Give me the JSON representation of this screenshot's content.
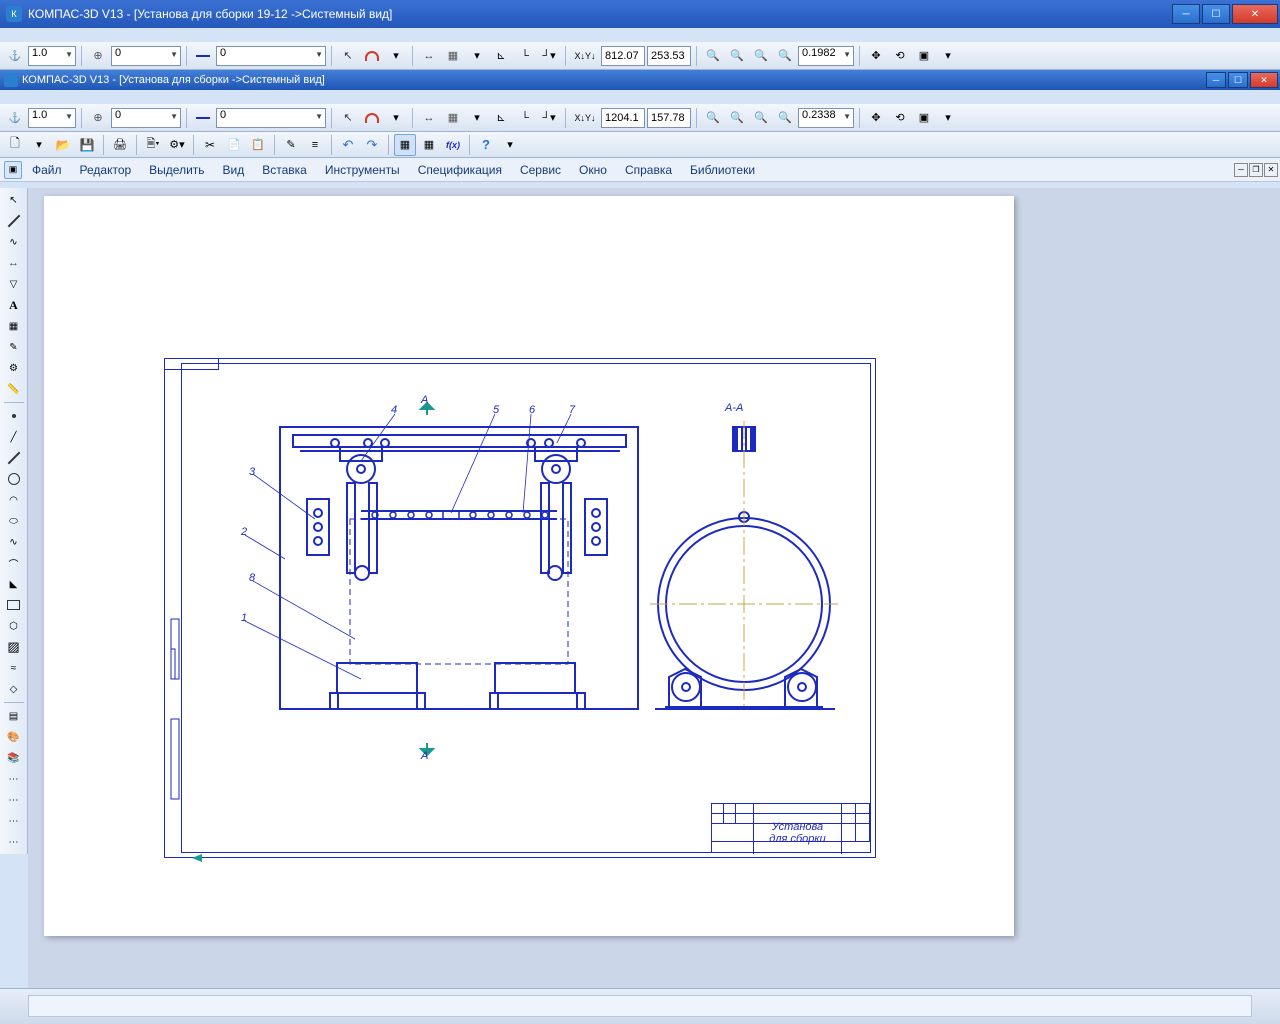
{
  "app": {
    "title": "КОМПАС-3D V13 - [Установа для  сборки 19-12 ->Системный вид]",
    "doc_title": "КОМПАС-3D V13 - [Установа для сборки ->Системный вид]"
  },
  "toolbar1": {
    "scale": "1.0",
    "step": "0",
    "style": "0",
    "coord_x": "812.07",
    "coord_y": "253.53",
    "zoom": "0.1982"
  },
  "toolbar2": {
    "scale": "1.0",
    "step": "0",
    "style": "0",
    "coord_x": "1204.1",
    "coord_y": "157.78",
    "zoom": "0.2338"
  },
  "menu": {
    "file": "Файл",
    "editor": "Редактор",
    "select": "Выделить",
    "view": "Вид",
    "insert": "Вставка",
    "tools": "Инструменты",
    "specification": "Спецификация",
    "service": "Сервис",
    "window": "Окно",
    "help": "Справка",
    "libraries": "Библиотеки"
  },
  "drawing": {
    "section_label": "А-А",
    "titleblock_name1": "Установа",
    "titleblock_name2": "для сборки",
    "leader_1": "1",
    "leader_2": "2",
    "leader_3": "3",
    "leader_4": "4",
    "leader_5": "5",
    "leader_6": "6",
    "leader_7": "7",
    "leader_8": "8",
    "section_A": "А"
  },
  "xy_label": "X Y"
}
